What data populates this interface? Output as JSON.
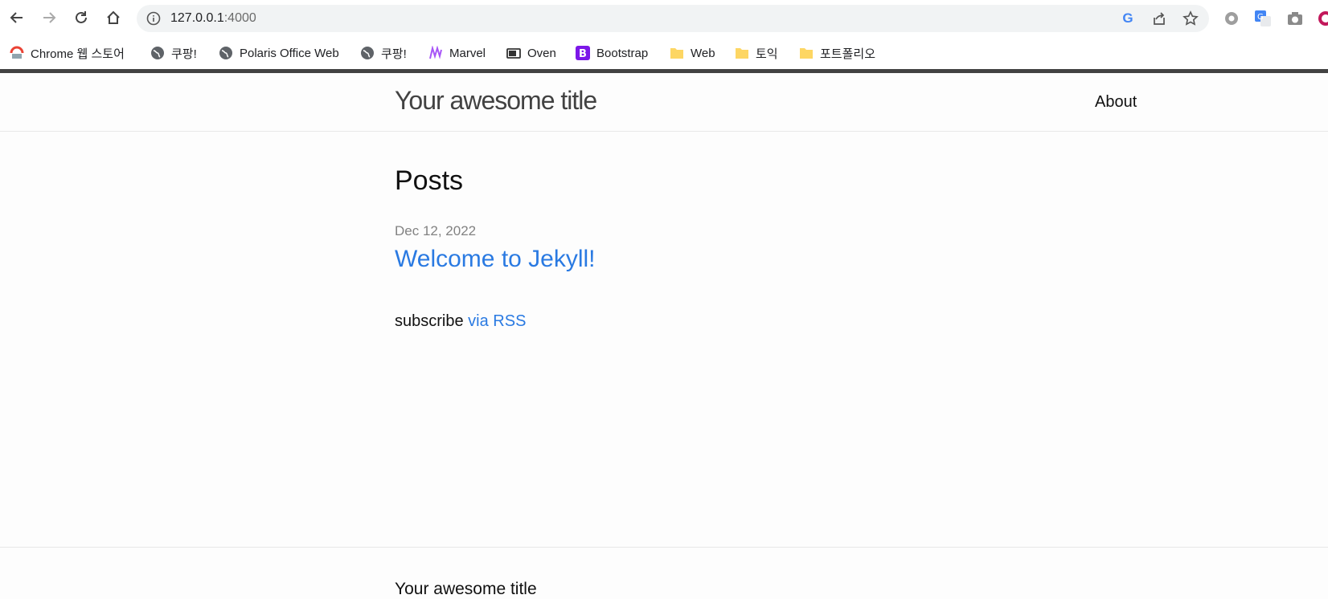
{
  "browser": {
    "url_host": "127.0.0.1",
    "url_port": ":4000",
    "bookmarks": [
      {
        "label": "Chrome 웹 스토어",
        "icon": "chrome-web-store-icon"
      },
      {
        "label": "쿠팡!",
        "icon": "globe-icon"
      },
      {
        "label": "Polaris Office Web",
        "icon": "globe-icon"
      },
      {
        "label": "쿠팡!",
        "icon": "globe-icon"
      },
      {
        "label": "Marvel",
        "icon": "marvel-icon"
      },
      {
        "label": "Oven",
        "icon": "oven-icon"
      },
      {
        "label": "Bootstrap",
        "icon": "bootstrap-icon"
      },
      {
        "label": "Web",
        "icon": "folder-icon"
      },
      {
        "label": "토익",
        "icon": "folder-icon"
      },
      {
        "label": "포트폴리오",
        "icon": "folder-icon"
      }
    ]
  },
  "site": {
    "title": "Your awesome title",
    "nav_about": "About"
  },
  "main": {
    "heading": "Posts",
    "posts": [
      {
        "date": "Dec 12, 2022",
        "title": "Welcome to Jekyll!"
      }
    ],
    "subscribe_text": "subscribe",
    "rss_link": "via RSS"
  },
  "footer": {
    "heading": "Your awesome title"
  },
  "colors": {
    "link": "#2a7ae2",
    "meta": "#828282",
    "header_bar": "#424242"
  }
}
